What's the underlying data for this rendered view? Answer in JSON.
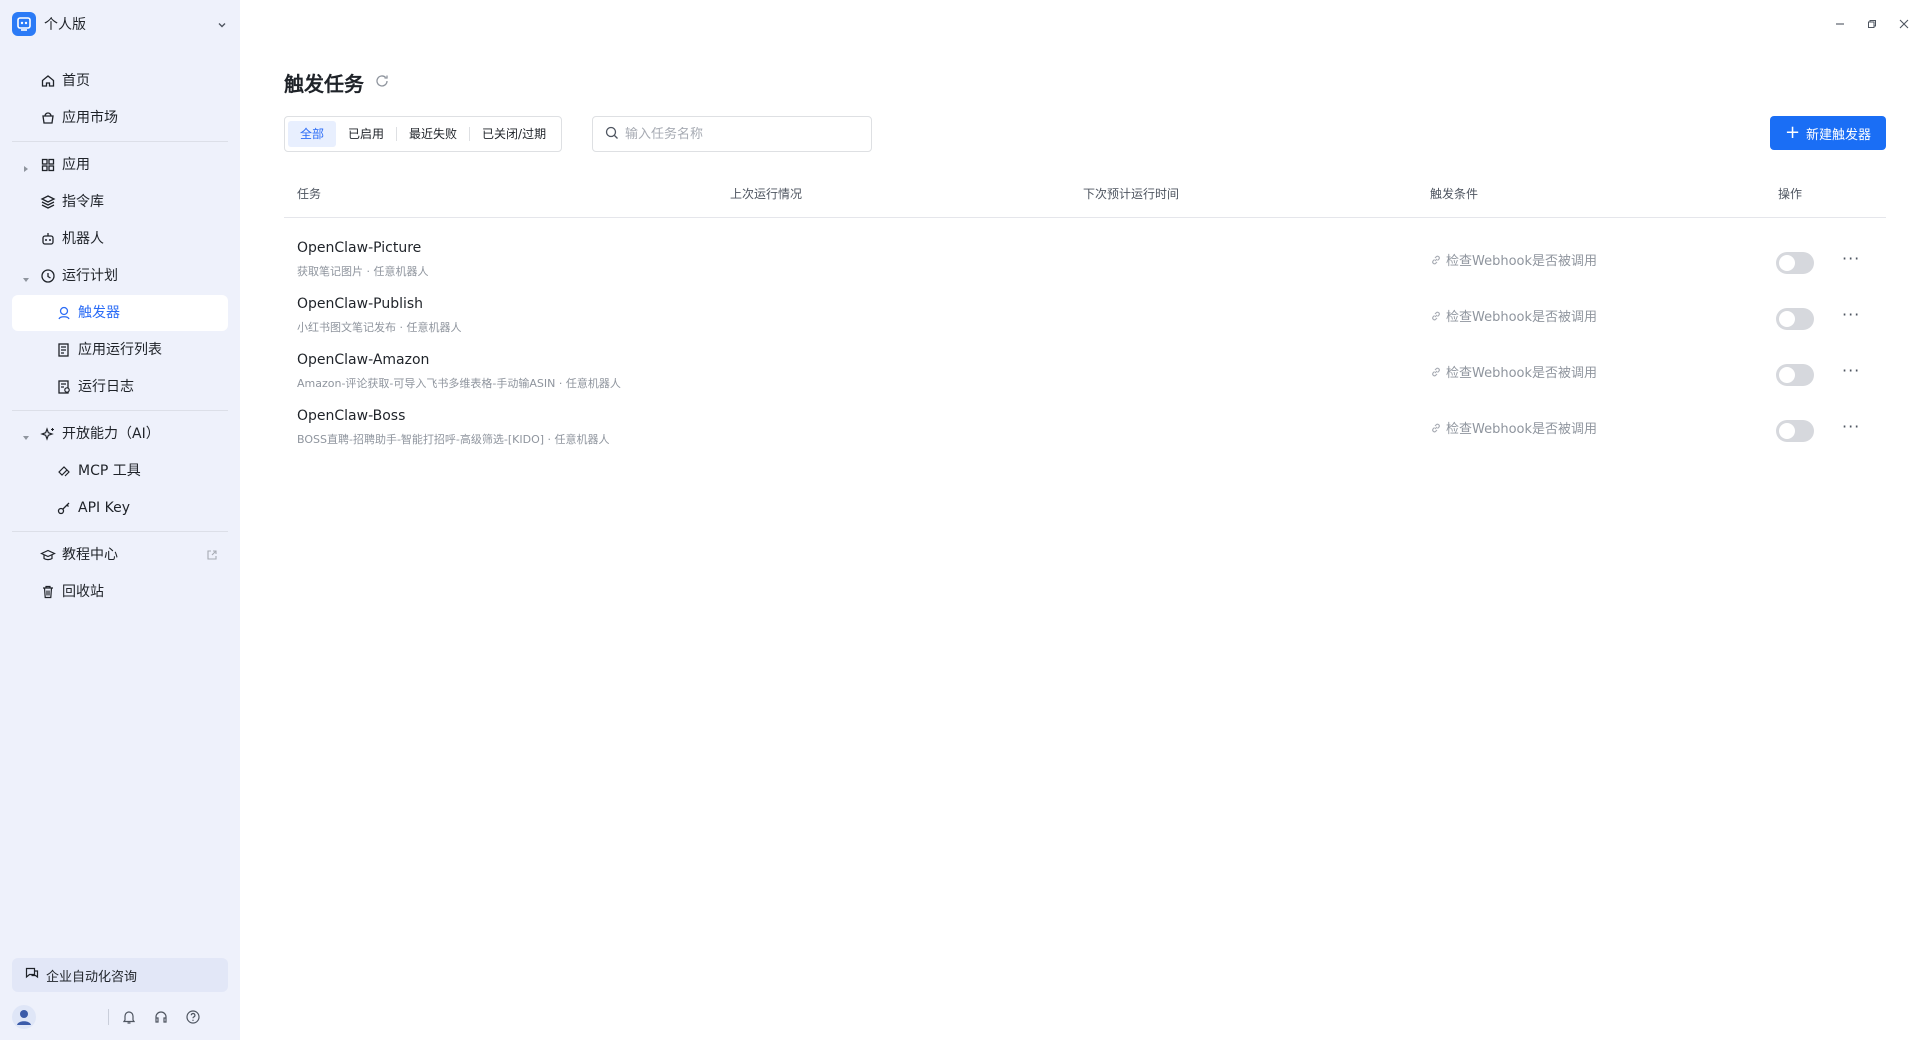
{
  "workspace": {
    "name": "个人版"
  },
  "nav": {
    "home": "首页",
    "market": "应用市场",
    "apps": "应用",
    "commands": "指令库",
    "robots": "机器人",
    "plans": "运行计划",
    "triggers": "触发器",
    "app_run_list": "应用运行列表",
    "run_log": "运行日志",
    "open_ability": "开放能力（AI）",
    "mcp": "MCP 工具",
    "apikey": "API Key",
    "tutorial": "教程中心",
    "recycle": "回收站"
  },
  "consult": "企业自动化咨询",
  "page": {
    "title": "触发任务"
  },
  "filters": [
    "全部",
    "已启用",
    "最近失败",
    "已关闭/过期"
  ],
  "search": {
    "placeholder": "输入任务名称"
  },
  "new_button": "新建触发器",
  "columns": {
    "task": "任务",
    "last_run": "上次运行情况",
    "next_run": "下次预计运行时间",
    "condition": "触发条件",
    "action": "操作"
  },
  "rows": [
    {
      "name": "OpenClaw-Picture",
      "desc": "获取笔记图片 · 任意机器人",
      "condition": "检查Webhook是否被调用",
      "enabled": false
    },
    {
      "name": "OpenClaw-Publish",
      "desc": "小红书图文笔记发布 · 任意机器人",
      "condition": "检查Webhook是否被调用",
      "enabled": false
    },
    {
      "name": "OpenClaw-Amazon",
      "desc": "Amazon-评论获取-可导入飞书多维表格-手动输ASIN · 任意机器人",
      "condition": "检查Webhook是否被调用",
      "enabled": false
    },
    {
      "name": "OpenClaw-Boss",
      "desc": "BOSS直聘-招聘助手-智能打招呼-高级筛选-[KIDO] · 任意机器人",
      "condition": "检查Webhook是否被调用",
      "enabled": false
    }
  ],
  "colors": {
    "accent": "#1a6ef5",
    "sidebar_bg": "#eef1fb"
  }
}
